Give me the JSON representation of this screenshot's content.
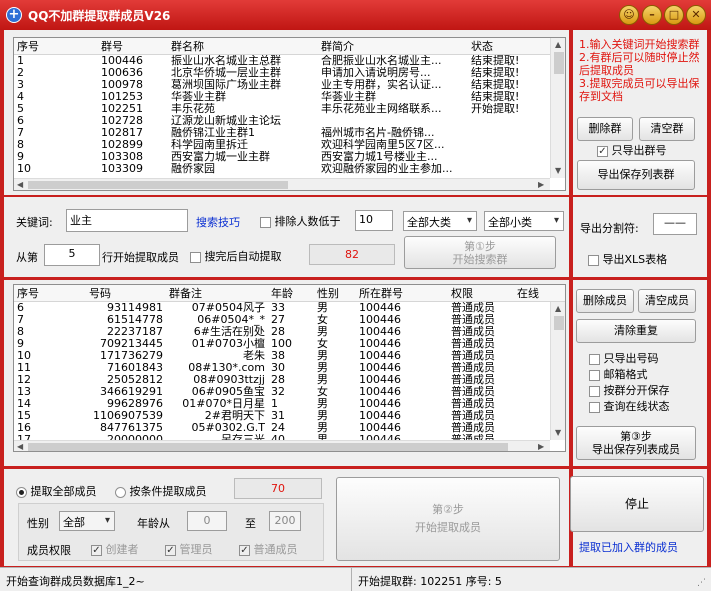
{
  "window": {
    "title": "QQ不加群提取群成员V26"
  },
  "groups_table": {
    "headers": [
      "序号",
      "群号",
      "群名称",
      "群简介",
      "状态"
    ],
    "rows": [
      [
        "1",
        "100446",
        "振业山水名城业主总群",
        "合肥振业山水名城业主...",
        "结束提取!"
      ],
      [
        "2",
        "100636",
        "北京华侨城一层业主群",
        "申请加入请说明房号...",
        "结束提取!"
      ],
      [
        "3",
        "100978",
        "葛洲坝国际广场业主群",
        "业主专用群，实名认证...",
        "结束提取!"
      ],
      [
        "4",
        "101253",
        "华荟业主群",
        "华荟业主群",
        "结束提取!"
      ],
      [
        "5",
        "102251",
        "丰乐花苑",
        "丰乐花苑业主网络联系...",
        "开始提取!"
      ],
      [
        "6",
        "102728",
        "辽源龙山新城业主论坛",
        "",
        ""
      ],
      [
        "7",
        "102817",
        "融侨锦江业主群1",
        "福州城市名片-融侨锦...",
        ""
      ],
      [
        "8",
        "102899",
        "科学园南里拆迁",
        "欢迎科学园南里5区7区...",
        ""
      ],
      [
        "9",
        "103308",
        "西安富力城一业主群",
        "西安富力城1号楼业主...",
        ""
      ],
      [
        "10",
        "103309",
        "融侨家园",
        "欢迎融侨家园的业主参加...",
        ""
      ]
    ]
  },
  "instructions": {
    "line1": "1.输入关键词开始搜索群",
    "line2": "2.有群后可以随时停止然后提取成员",
    "line3": "3.提取完成员可以导出保存到文档"
  },
  "group_actions": {
    "delete_group": "删除群",
    "clear_groups": "清空群",
    "export_group_no_only": "只导出群号",
    "export_group_list": "导出保存列表群"
  },
  "search_bar": {
    "keyword_label": "关键词:",
    "keyword_value": "业主",
    "tips_link": "搜索技巧",
    "exclude_label": "排除人数低于",
    "exclude_value": "10",
    "category_big": "全部大类",
    "category_small": "全部小类",
    "start_from_label": "从第",
    "start_row": "5",
    "start_suffix": "行开始提取成员",
    "auto_extract_label": "搜完后自动提取",
    "count": "82",
    "step1_line1": "第①步",
    "step1_line2": "开始搜索群"
  },
  "export_options": {
    "separator_label": "导出分割符:",
    "separator_value": "——",
    "xls_label": "导出XLS表格"
  },
  "members_table": {
    "headers": [
      "序号",
      "号码",
      "群备注",
      "年龄",
      "性别",
      "所在群号",
      "权限",
      "在线"
    ],
    "rows": [
      [
        "6",
        "93114981",
        "07#0504风子",
        "33",
        "男",
        "100446",
        "普通成员",
        ""
      ],
      [
        "7",
        "61514778",
        "06#0504*_*",
        "27",
        "女",
        "100446",
        "普通成员",
        ""
      ],
      [
        "8",
        "22237187",
        "6#生活在别处",
        "28",
        "男",
        "100446",
        "普通成员",
        ""
      ],
      [
        "9",
        "709213445",
        "01#0703小檀",
        "100",
        "女",
        "100446",
        "普通成员",
        ""
      ],
      [
        "10",
        "171736279",
        "老朱",
        "38",
        "男",
        "100446",
        "普通成员",
        ""
      ],
      [
        "11",
        "71601843",
        "08#130*.com",
        "30",
        "男",
        "100446",
        "普通成员",
        ""
      ],
      [
        "12",
        "25052812",
        "08#0903ttzjj",
        "28",
        "男",
        "100446",
        "普通成员",
        ""
      ],
      [
        "13",
        "346619291",
        "06#0905鱼宝",
        "32",
        "女",
        "100446",
        "普通成员",
        ""
      ],
      [
        "14",
        "99628976",
        "01#070*日月星",
        "1",
        "男",
        "100446",
        "普通成员",
        ""
      ],
      [
        "15",
        "1106907539",
        "2#君明天下",
        "31",
        "男",
        "100446",
        "普通成员",
        ""
      ],
      [
        "16",
        "847761375",
        "05#0302.G.T",
        "24",
        "男",
        "100446",
        "普通成员",
        ""
      ],
      [
        "17",
        "20000000",
        "另存三光",
        "40",
        "男",
        "100446",
        "普通成员",
        ""
      ]
    ]
  },
  "member_actions": {
    "delete_member": "删除成员",
    "clear_members": "清空成员",
    "clear_duplicates": "清除重复",
    "opt_number_only": "只导出号码",
    "opt_email": "邮箱格式",
    "opt_by_group": "按群分开保存",
    "opt_online": "查询在线状态",
    "step3_line1": "第③步",
    "step3_line2": "导出保存列表成员"
  },
  "extract_panel": {
    "radio_all": "提取全部成员",
    "radio_cond": "按条件提取成员",
    "count": "70",
    "gender_label": "性别",
    "gender_value": "全部",
    "age_label": "年龄从",
    "age_from": "0",
    "age_to_label": "至",
    "age_to": "200",
    "perm_label": "成员权限",
    "perm_creator": "创建者",
    "perm_admin": "管理员",
    "perm_member": "普通成员",
    "step2_line1": "第②步",
    "step2_line2": "开始提取成员"
  },
  "stop_panel": {
    "stop": "停止",
    "link": "提取已加入群的成员"
  },
  "statusbar": {
    "left": "开始查询群成员数据库1_2~",
    "right": "开始提取群: 102251 序号: 5"
  }
}
